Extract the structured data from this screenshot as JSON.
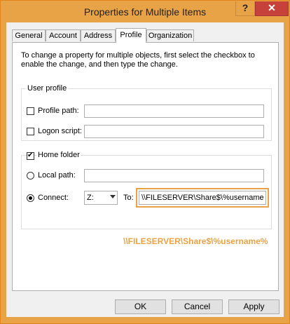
{
  "window": {
    "title": "Properties for Multiple Items",
    "help_glyph": "?",
    "close_glyph": "✕"
  },
  "tabs": [
    {
      "label": "General"
    },
    {
      "label": "Account"
    },
    {
      "label": "Address"
    },
    {
      "label": "Profile",
      "active": true
    },
    {
      "label": "Organization"
    }
  ],
  "description": "To change a property for multiple objects, first select the checkbox to enable the change, and then type the change.",
  "user_profile": {
    "legend": "User profile",
    "profile_path": {
      "label": "Profile path:",
      "checked": false,
      "value": ""
    },
    "logon_script": {
      "label": "Logon script:",
      "checked": false,
      "value": ""
    }
  },
  "home_folder": {
    "legend": "Home folder",
    "checked": true,
    "local_path": {
      "label": "Local path:",
      "selected": false,
      "value": ""
    },
    "connect": {
      "label": "Connect:",
      "selected": true,
      "drive": "Z:",
      "to_label": "To:",
      "path": "\\\\FILESERVER\\Share$\\%username"
    }
  },
  "annotation": "\\\\FILESERVER\\Share$\\%username%",
  "buttons": {
    "ok": "OK",
    "cancel": "Cancel",
    "apply": "Apply"
  },
  "colors": {
    "accent": "#e8a346",
    "close": "#c7413b"
  }
}
